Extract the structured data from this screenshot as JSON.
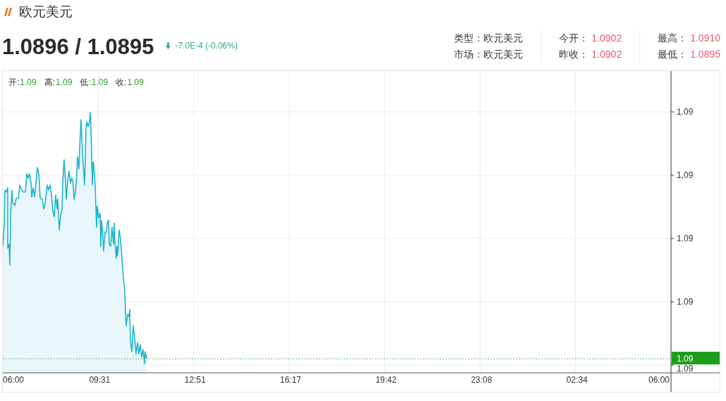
{
  "header": {
    "title": "欧元美元"
  },
  "quote": {
    "price": "1.0896 / 1.0895",
    "change": "-7.0E-4 (-0.06%)",
    "rising": false
  },
  "details": [
    {
      "label": "类型：",
      "value": "欧元美元",
      "kind": "text"
    },
    {
      "label": "今开：",
      "value": "1.0902",
      "kind": "price"
    },
    {
      "label": "最高：",
      "value": "1.0910",
      "kind": "price"
    },
    {
      "label": "市场：",
      "value": "欧元美元",
      "kind": "text"
    },
    {
      "label": "昨收：",
      "value": "1.0902",
      "kind": "price"
    },
    {
      "label": "最低：",
      "value": "1.0895",
      "kind": "price"
    }
  ],
  "chart": {
    "ohlc": [
      {
        "label": "开:",
        "value": "1.09"
      },
      {
        "label": "高:",
        "value": "1.09"
      },
      {
        "label": "低:",
        "value": "1.09"
      },
      {
        "label": "收:",
        "value": "1.09"
      }
    ],
    "y_axis_labels": [
      "1.09",
      "1.09",
      "1.09",
      "1.09",
      "1.09"
    ],
    "x_axis_labels": [
      "06:00",
      "09:31",
      "12:51",
      "16:17",
      "19:42",
      "23:08",
      "02:34",
      "06:00"
    ],
    "current_price": "1.09"
  }
}
